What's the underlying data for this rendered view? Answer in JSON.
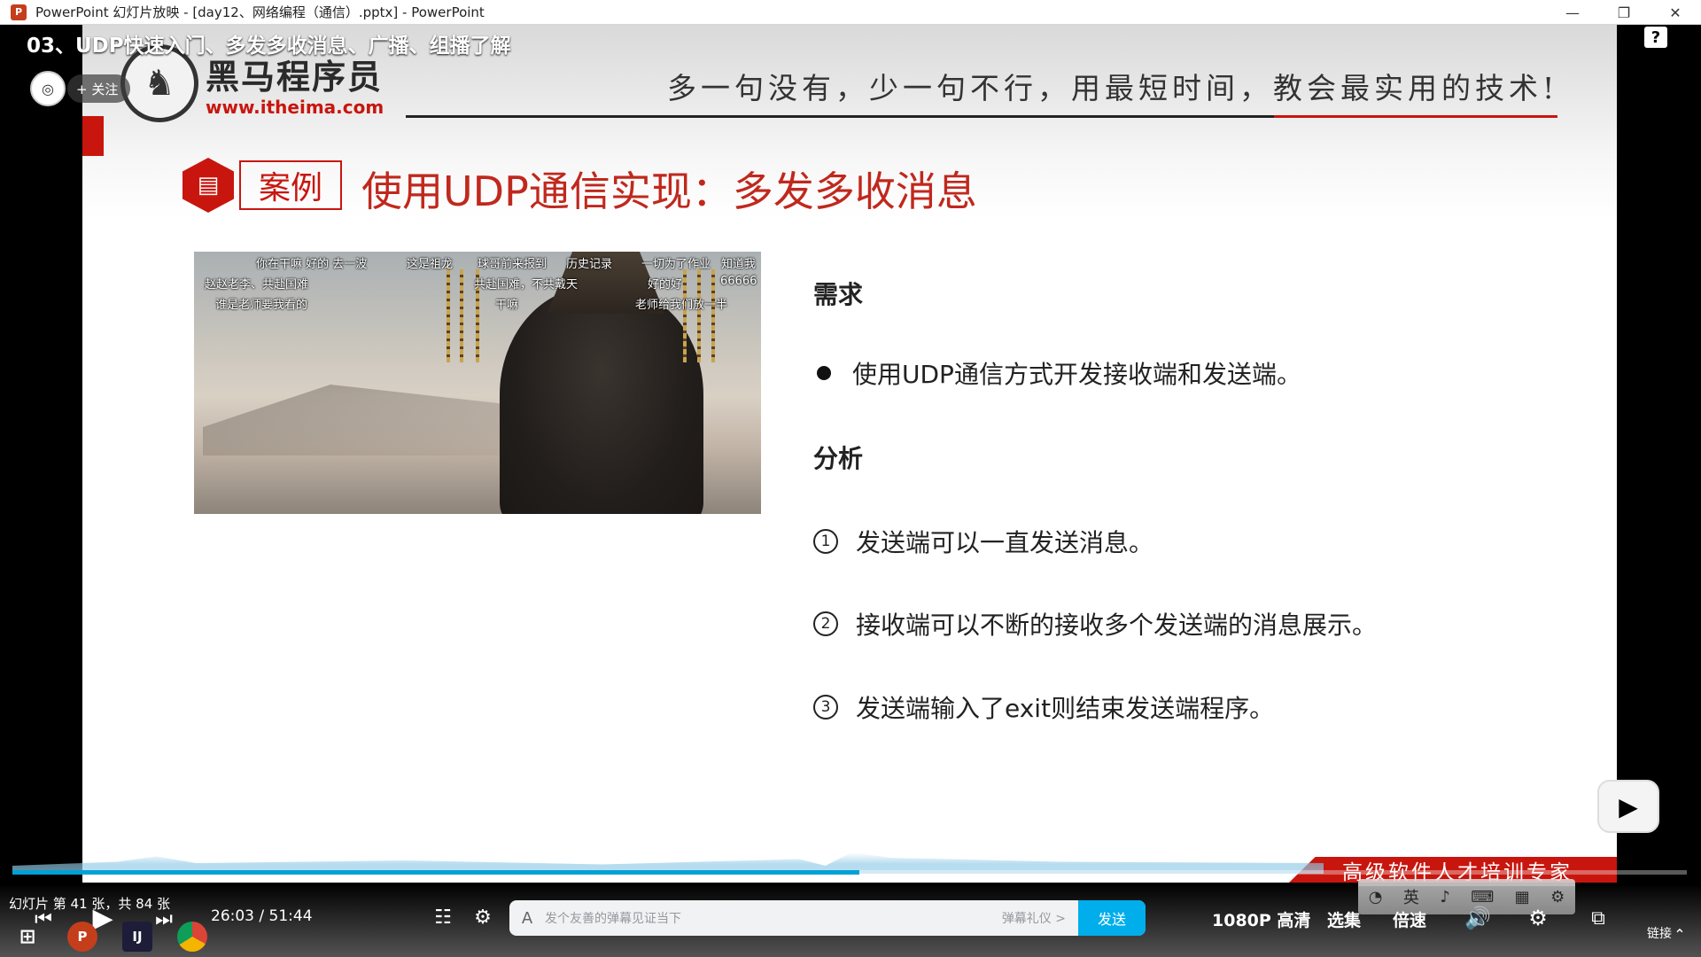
{
  "window": {
    "title": "PowerPoint 幻灯片放映 - [day12、网络编程（通信）.pptx] - PowerPoint",
    "app_icon": "P",
    "minimize": "—",
    "restore": "❐",
    "close": "✕"
  },
  "video": {
    "title": "03、UDP快速入门、多发多收消息、广播、组播了解",
    "help": "?",
    "follow_label": "+ 关注",
    "avatar_text": "◎"
  },
  "slide": {
    "logo_cn": "黑马程序员",
    "logo_url": "www.itheima.com",
    "slogan": "多一句没有，少一句不行，用最短时间，教会最实用的技术!",
    "case_label": "案例",
    "case_title": "使用UDP通信实现：多发多收消息",
    "requirement_title": "需求",
    "requirement_bullet": "使用UDP通信方式开发接收端和发送端。",
    "analysis_title": "分析",
    "steps": [
      {
        "num": "1",
        "text": "发送端可以一直发送消息。"
      },
      {
        "num": "2",
        "text": "接收端可以不断的接收多个发送端的消息展示。"
      },
      {
        "num": "3",
        "text": "发送端输入了exit则结束发送端程序。"
      }
    ],
    "brand_slogan": "高级软件人才培训专家",
    "danmaku": [
      "你在干嘛 好的 去一波",
      "这是祖龙",
      "球哥前来报到",
      "历史记录",
      "一切为了作业",
      "知道我",
      "赵赵老李、共赴国难",
      "共赴国难，不共戴天",
      "好的好",
      "66666",
      "谁是老师要我看的",
      "干嘛",
      "老师给我们放一半"
    ],
    "mini_toolbar": [
      "◔",
      "英",
      "♪",
      "⌨",
      "▦",
      "⚙"
    ]
  },
  "player": {
    "slide_counter": "幻灯片 第 41 张，共 84 张",
    "current_time": "26:03",
    "time_sep": "/",
    "total_time": "51:44",
    "progress": 0.506,
    "danmaku_placeholder": "发个友善的弹幕见证当下",
    "danmaku_etiquette": "弹幕礼仪 >",
    "send_label": "发送",
    "quality": "1080P 高清",
    "episodes": "选集",
    "speed": "倍速",
    "link_label": "链接",
    "accent": "#00aeec"
  },
  "colors": {
    "brand_red": "#c8160e",
    "title_red": "#c0281d"
  }
}
